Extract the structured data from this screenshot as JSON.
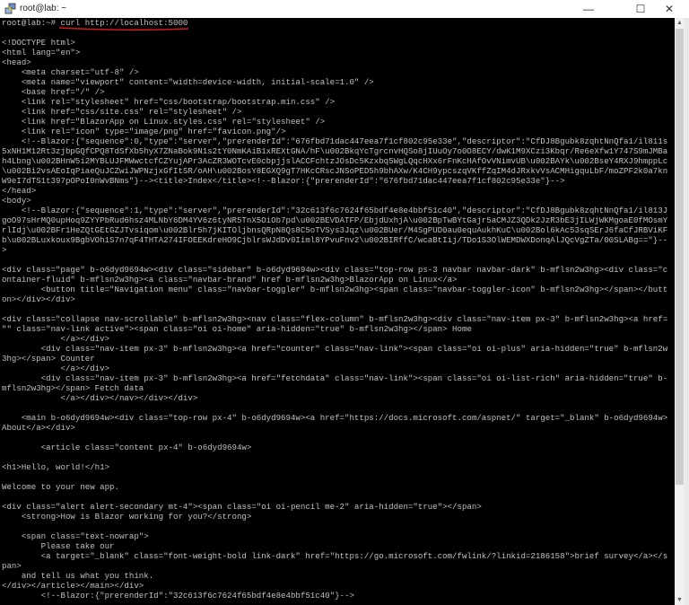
{
  "window": {
    "title": "root@lab: ~",
    "minimize": "—",
    "maximize": "☐",
    "close": "✕"
  },
  "scrollbar": {
    "up": "▲",
    "down": "▼",
    "position_percent": 0
  },
  "accent": {
    "underline_color": "#d11a1a",
    "text_color": "#c0c0c0",
    "background": "#000000"
  },
  "terminal": {
    "lines": [
      "root@lab:~# curl http://localhost:5000",
      "",
      "<!DOCTYPE html>",
      "<html lang=\"en\">",
      "<head>",
      "    <meta charset=\"utf-8\" />",
      "    <meta name=\"viewport\" content=\"width=device-width, initial-scale=1.0\" />",
      "    <base href=\"/\" />",
      "    <link rel=\"stylesheet\" href=\"css/bootstrap/bootstrap.min.css\" />",
      "    <link href=\"css/site.css\" rel=\"stylesheet\" />",
      "    <link href=\"BlazorApp on Linux.styles.css\" rel=\"stylesheet\" />",
      "    <link rel=\"icon\" type=\"image/png\" href=\"favicon.png\"/>",
      "    <!--Blazor:{\"sequence\":0,\"type\":\"server\",\"prerenderId\":\"676fbd71dac447eea7f1cf802c95e33e\",\"descriptor\":\"CfDJ8Bgubk8zqhtNnQfa1/il811s",
      "5xNH1M12Rt3zjbpGQfCPQ8TdSfXb5hyX7ZNaBok9N1s2tY0NmKAiB1xREXtGNA/hF\\u002BkqYcTgrcnvHQSo8jIUuOy7o0O8ECY/dwK1M9XCzi3Kbqr/Re6eXfw1Y747S9mJMBa",
      "h4Lbng\\u002BHnW5i2MYBLUJFMWwctcfCZYujAPr3AcZR3WOTcvE0cbpjjslACCFchtzJOsDc5Kzxbq5WgLQqcHXx6rFnKcHAfOvVNimvUB\\u002BAYk\\u002BseY4RXJ9hmppLc",
      "\\u002Bi2vsAEoIqPiaeQuJCZwiJWPNzjxGfItSR/oAH\\u002BosY8EGXQ9gT7HKcCRscJNSoPED5h9bhAXw/K4CH9ypcszqVKffZqIM4dJRxkvVsACMHigquLbF/moZPF2k0a7kn",
      "W9eI7dTS1t397pOPoI0nWvBNms\"}--><title>Index</title><!--Blazor:{\"prerenderId\":\"676fbd71dac447eea7f1cf802c95e33e\"}-->",
      "</head>",
      "<body>",
      "    <!--Blazor:{\"sequence\":1,\"type\":\"server\",\"prerenderId\":\"32c613f6c7624f65bdf4e8e4bbf51c40\",\"descriptor\":\"CfDJ8Bgubk8zqhtNnQfa1/il813J",
      "goO97sHrMQ0upHoq9ZYYPbRud6hsz4MLNbY6DM4YV6z6tyNR5TnX5OiOb7pd\\u002BEVDATFP/EbjdUxhjA\\u002BpTwBYtGajr5aCMJZ3QDk2JzR3bE3jILWjWKMgoaE0fMOsmY",
      "rlIdj\\u002BFr1HeZQtGEtGZJTvsiqom\\u002Blr5h7jKITOljbnsQRpN8Qs8C5oTVSys3Jqz\\u002BUer/M4SgPUD0au0equAukhKuC\\u002Bol6kAc53sqSErJ6faCfJRBViKF",
      "b\\u002BLuxkoux9BgbVOh1S7n7qF4THTA274IFOEEKdreHO9CjblrsWJdDv0Iiml8YPvuFnv2\\u002BIRffC/wcaBtIij/TDo1S3OlWEMDWXDonqAlJQcVgZTa/00SLABg==\"}--",
      ">",
      "",
      "<div class=\"page\" b-o6dyd9694w><div class=\"sidebar\" b-o6dyd9694w><div class=\"top-row ps-3 navbar navbar-dark\" b-mflsn2w3hg><div class=\"c",
      "ontainer-fluid\" b-mflsn2w3hg><a class=\"navbar-brand\" href b-mflsn2w3hg>BlazorApp on Linux</a>",
      "        <button title=\"Navigation menu\" class=\"navbar-toggler\" b-mflsn2w3hg><span class=\"navbar-toggler-icon\" b-mflsn2w3hg></span></butt",
      "on></div></div>",
      "",
      "<div class=\"collapse nav-scrollable\" b-mflsn2w3hg><nav class=\"flex-column\" b-mflsn2w3hg><div class=\"nav-item px-3\" b-mflsn2w3hg><a href=",
      "\"\" class=\"nav-link active\"><span class=\"oi oi-home\" aria-hidden=\"true\" b-mflsn2w3hg></span> Home",
      "            </a></div>",
      "        <div class=\"nav-item px-3\" b-mflsn2w3hg><a href=\"counter\" class=\"nav-link\"><span class=\"oi oi-plus\" aria-hidden=\"true\" b-mflsn2w",
      "3hg></span> Counter",
      "            </a></div>",
      "        <div class=\"nav-item px-3\" b-mflsn2w3hg><a href=\"fetchdata\" class=\"nav-link\"><span class=\"oi oi-list-rich\" aria-hidden=\"true\" b-",
      "mflsn2w3hg></span> Fetch data",
      "            </a></div></nav></div></div>",
      "",
      "    <main b-o6dyd9694w><div class=\"top-row px-4\" b-o6dyd9694w><a href=\"https://docs.microsoft.com/aspnet/\" target=\"_blank\" b-o6dyd9694w>",
      "About</a></div>",
      "",
      "        <article class=\"content px-4\" b-o6dyd9694w>",
      "",
      "<h1>Hello, world!</h1>",
      "",
      "Welcome to your new app.",
      "",
      "<div class=\"alert alert-secondary mt-4\"><span class=\"oi oi-pencil me-2\" aria-hidden=\"true\"></span>",
      "    <strong>How is Blazor working for you?</strong>",
      "",
      "    <span class=\"text-nowrap\">",
      "        Please take our",
      "        <a target=\"_blank\" class=\"font-weight-bold link-dark\" href=\"https://go.microsoft.com/fwlink/?linkid=2186158\">brief survey</a></s",
      "pan>",
      "    and tell us what you think.",
      "</div></article></main></div>",
      "        <!--Blazor:{\"prerenderId\":\"32c613f6c7624f65bdf4e8e4bbf51c40\"}-->"
    ]
  }
}
